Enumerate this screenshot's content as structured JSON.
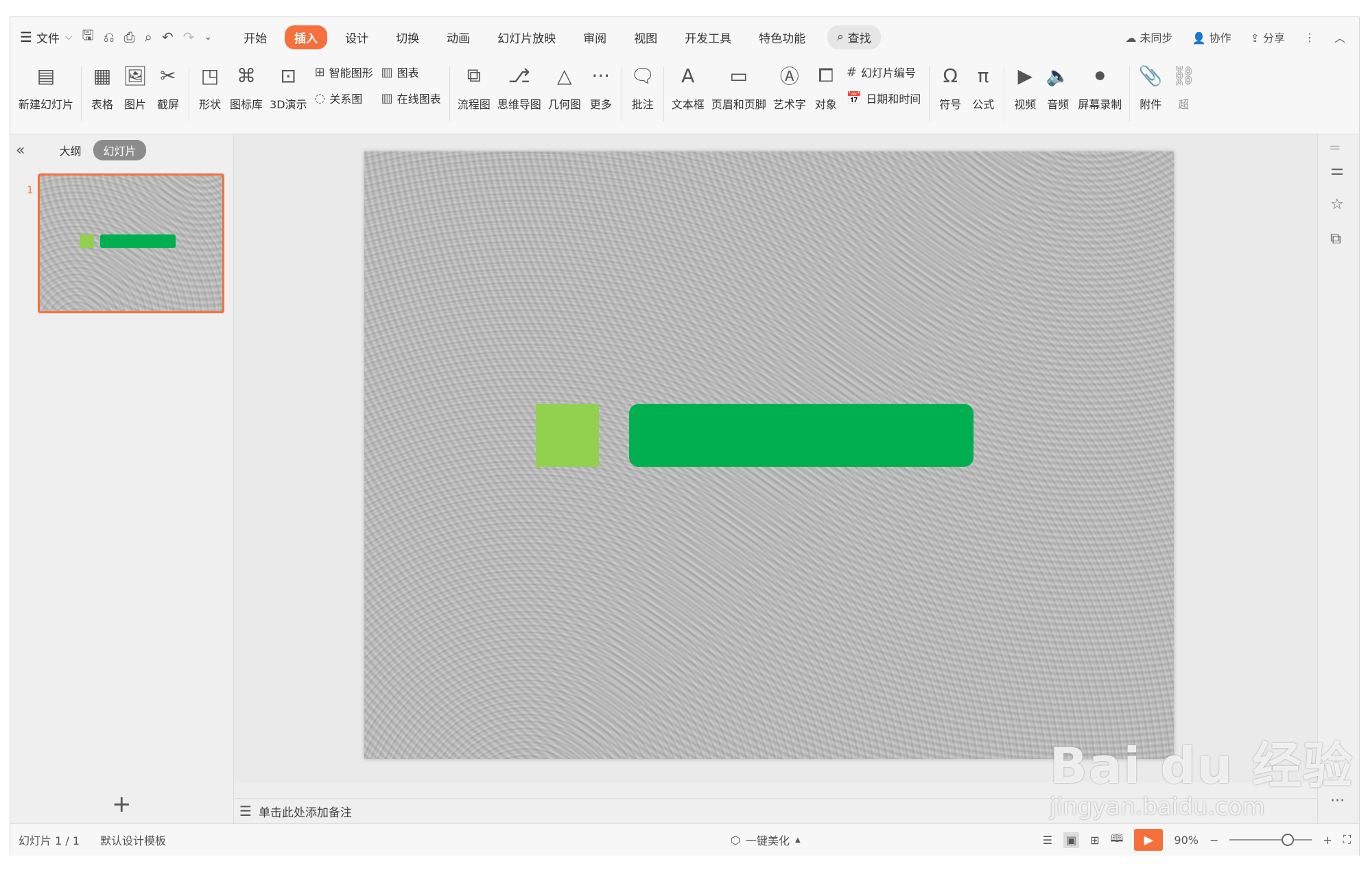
{
  "menubar": {
    "file_label": "文件",
    "tabs": [
      "开始",
      "插入",
      "设计",
      "切换",
      "动画",
      "幻灯片放映",
      "审阅",
      "视图",
      "开发工具",
      "特色功能"
    ],
    "active_tab": "插入",
    "search_label": "查找",
    "sync_label": "未同步",
    "collab_label": "协作",
    "share_label": "分享"
  },
  "ribbon": {
    "new_slide": "新建幻灯片",
    "table": "表格",
    "picture": "图片",
    "screenshot": "截屏",
    "shape": "形状",
    "icon_lib": "图标库",
    "demo3d": "3D演示",
    "smart_graphic": "智能图形",
    "chart": "图表",
    "relation": "关系图",
    "online_chart": "在线图表",
    "flowchart": "流程图",
    "mindmap": "思维导图",
    "geometry": "几何图",
    "more": "更多",
    "comment": "批注",
    "textbox": "文本框",
    "header_footer": "页眉和页脚",
    "wordart": "艺术字",
    "object": "对象",
    "slide_number": "幻灯片编号",
    "datetime": "日期和时间",
    "symbol": "符号",
    "formula": "公式",
    "video": "视频",
    "audio": "音频",
    "screen_record": "屏幕录制",
    "attachment": "附件",
    "overflow": "超"
  },
  "left_panel": {
    "outline_tab": "大纲",
    "slides_tab": "幻灯片",
    "slide_number": "1"
  },
  "slide": {
    "square_color": "#92d050",
    "bar_color": "#00b050"
  },
  "notes": {
    "placeholder": "单击此处添加备注"
  },
  "statusbar": {
    "slide_info": "幻灯片 1 / 1",
    "template": "默认设计模板",
    "beautify": "一键美化",
    "zoom": "90%"
  },
  "watermark": {
    "brand": "Bai du 经验",
    "url": "jingyan.baidu.com"
  }
}
